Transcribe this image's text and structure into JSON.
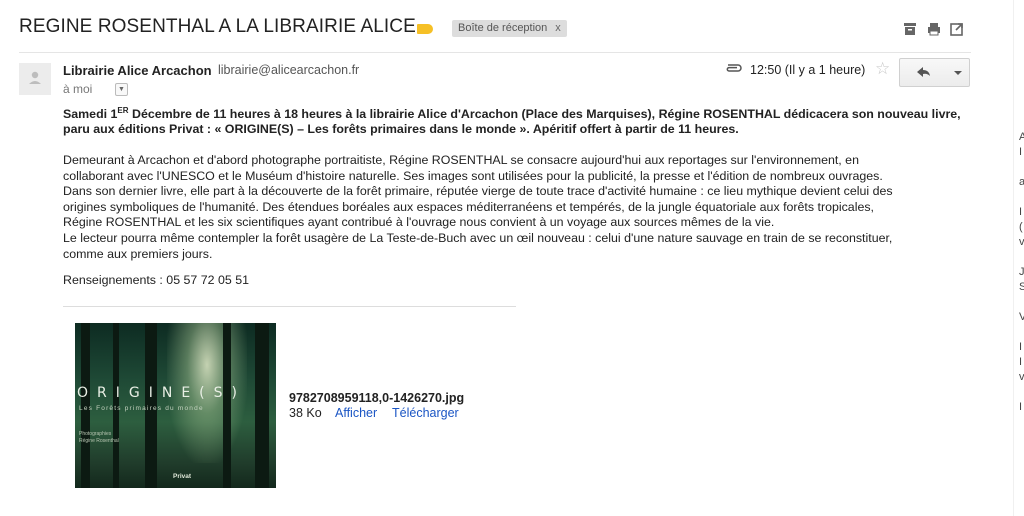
{
  "email": {
    "subject": "REGINE ROSENTHAL A LA LIBRAIRIE ALICE",
    "label_color": "#f6c026",
    "inbox_chip": "Boîte de réception",
    "inbox_chip_close": "x",
    "toolbar_icons": [
      "archive-icon",
      "print-icon",
      "new-window-icon"
    ]
  },
  "message": {
    "sender_name": "Librairie Alice Arcachon",
    "sender_email": "librairie@alicearcachon.fr",
    "to": "à moi",
    "time": "12:50 (Il y a 1 heure)",
    "lead_part1": "Samedi 1",
    "lead_sup": "ER",
    "lead_part2": " Décembre de 11 heures à 18 heures à la librairie Alice d'Arcachon (Place des Marquises), Régine ROSENTHAL dédicacera son nouveau livre, paru aux éditions Privat : « ORIGINE(S) – Les forêts primaires dans le monde ». Apéritif offert à partir de 11 heures.",
    "paragraph_lines": [
      "Demeurant à Arcachon et d'abord photographe portraitiste, Régine ROSENTHAL se consacre aujourd'hui aux reportages sur l'environnement, en",
      "collaborant avec l'UNESCO et le Muséum d'histoire naturelle. Ses images sont utilisées pour la publicité, la presse et l'édition de nombreux ouvrages.",
      "Dans son dernier livre, elle part à la découverte de la forêt primaire, réputée vierge de toute trace d'activité humaine : ce lieu mythique devient celui des",
      "origines symboliques de l'humanité. Des étendues boréales aux espaces méditerranéens et tempérés, de la jungle équatoriale aux forêts tropicales,",
      "Régine ROSENTHAL et les six scientifiques ayant contribué à l'ouvrage nous convient à un voyage aux sources mêmes de la vie.",
      "Le lecteur pourra même contempler la forêt usagère de La Teste-de-Buch avec un œil nouveau : celui d'une nature sauvage en train de se reconstituer,",
      "comme aux premiers jours."
    ],
    "info": "Renseignements : 05 57 72 05 51"
  },
  "attachment": {
    "filename": "9782708959118,0-1426270.jpg",
    "size": "38 Ko",
    "view_label": "Afficher",
    "download_label": "Télécharger",
    "cover_title": "ORIGINE(S)",
    "cover_subtitle": "Les Forêts primaires du monde",
    "cover_author_lines": [
      "Photographies",
      "Régine Rosenthal"
    ],
    "cover_publisher": "Privat"
  },
  "right_panel": {
    "partial_letters": [
      "A",
      "I",
      "",
      "a",
      "",
      "I",
      "(",
      "v",
      "",
      "J",
      "S",
      "",
      "V",
      "",
      "I",
      "I",
      "v",
      "",
      "I"
    ]
  }
}
